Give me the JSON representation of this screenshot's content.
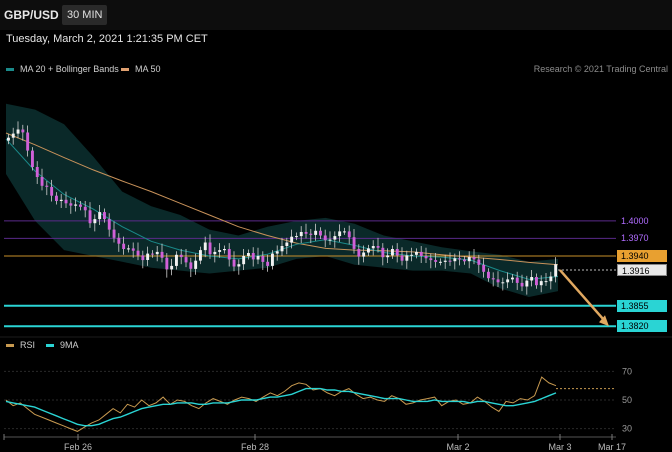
{
  "header": {
    "symbol": "GBP/USD",
    "timeframe": "30 MIN"
  },
  "datetime": "Tuesday, March 2, 2021 1:21:35 PM CET",
  "legend": {
    "items": [
      {
        "label": "MA 20 + Bollinger Bands",
        "color": "#1a8a8a"
      },
      {
        "label": "MA 50",
        "color": "#e0a070"
      }
    ],
    "credit": "Research © 2021 Trading Central"
  },
  "rsi_legend": {
    "items": [
      {
        "label": "RSI",
        "color": "#c89a50"
      },
      {
        "label": "9MA",
        "color": "#2ad4d4"
      }
    ]
  },
  "price_levels": [
    {
      "label": "1.4000",
      "color": "#a060e0",
      "text_color": "#b06cff",
      "bg": "",
      "line": "#5a2a8a"
    },
    {
      "label": "1.3970",
      "color": "#a060e0",
      "text_color": "#b06cff",
      "bg": "",
      "line": "#5a2a8a"
    },
    {
      "label": "1.3940",
      "color": "#e8a030",
      "text_color": "#000000",
      "bg": "#e8a030",
      "line": "#c8902a"
    },
    {
      "label": "1.3916",
      "color": "#ffffff",
      "text_color": "#000000",
      "bg": "#e8e8e8",
      "line": "#bbbbbb"
    },
    {
      "label": "1.3855",
      "color": "#2ad4d4",
      "text_color": "#000000",
      "bg": "#2ad4d4",
      "line": "#2ad4d4"
    },
    {
      "label": "1.3820",
      "color": "#2ad4d4",
      "text_color": "#000000",
      "bg": "#2ad4d4",
      "line": "#2ad4d4"
    }
  ],
  "chart_data": [
    {
      "type": "candlestick",
      "x_labels": [
        "Feb 26",
        "Feb 28",
        "Mar 2",
        "Mar 3",
        "Mar 17"
      ],
      "ylim": [
        1.3805,
        1.4215
      ],
      "grid": false,
      "series": [
        {
          "kind": "close",
          "values": [
            1.4142,
            1.4149,
            1.4156,
            1.4151,
            1.412,
            1.4092,
            1.4075,
            1.406,
            1.4058,
            1.4043,
            1.4034,
            1.4036,
            1.403,
            1.4026,
            1.4028,
            1.4024,
            1.4018,
            1.3996,
            1.4003,
            1.4015,
            1.4003,
            1.3985,
            1.3971,
            1.3961,
            1.3952,
            1.3953,
            1.3949,
            1.3941,
            1.3933,
            1.3944,
            1.3943,
            1.3947,
            1.3937,
            1.3917,
            1.3923,
            1.3942,
            1.3938,
            1.3929,
            1.3918,
            1.3932,
            1.395,
            1.3963,
            1.3943,
            1.3947,
            1.395,
            1.3952,
            1.3934,
            1.3922,
            1.3926,
            1.394,
            1.3945,
            1.3934,
            1.394,
            1.393,
            1.3923,
            1.3944,
            1.3948,
            1.3957,
            1.3963,
            1.3973,
            1.3974,
            1.3981,
            1.3978,
            1.3976,
            1.3983,
            1.3975,
            1.3967,
            1.3968,
            1.3974,
            1.3982,
            1.3982,
            1.3972,
            1.3952,
            1.3939,
            1.3946,
            1.3953,
            1.3957,
            1.3954,
            1.3938,
            1.3941,
            1.3952,
            1.3941,
            1.3932,
            1.3941,
            1.3942,
            1.3947,
            1.394,
            1.3936,
            1.3933,
            1.393,
            1.393,
            1.3932,
            1.3931,
            1.3936,
            1.3934,
            1.3931,
            1.3938,
            1.3934,
            1.3925,
            1.3913,
            1.3902,
            1.39,
            1.3895,
            1.3895,
            1.39,
            1.3903,
            1.3894,
            1.3888,
            1.3898,
            1.3904,
            1.389,
            1.3897,
            1.3897,
            1.3905,
            1.3926
          ]
        },
        {
          "kind": "open",
          "values": [
            1.4137,
            1.4142,
            1.4149,
            1.4156,
            1.4151,
            1.412,
            1.4092,
            1.4075,
            1.406,
            1.4058,
            1.4043,
            1.4034,
            1.4036,
            1.403,
            1.4026,
            1.4028,
            1.4024,
            1.4018,
            1.3996,
            1.4003,
            1.4015,
            1.4003,
            1.3985,
            1.3971,
            1.3961,
            1.3952,
            1.3953,
            1.3949,
            1.3941,
            1.3933,
            1.3944,
            1.3943,
            1.3947,
            1.3937,
            1.3917,
            1.3923,
            1.3942,
            1.3938,
            1.3929,
            1.3918,
            1.3932,
            1.395,
            1.3963,
            1.3943,
            1.3947,
            1.395,
            1.3952,
            1.3934,
            1.3922,
            1.3926,
            1.394,
            1.3945,
            1.3934,
            1.394,
            1.393,
            1.3923,
            1.3944,
            1.3948,
            1.3957,
            1.3963,
            1.3973,
            1.3974,
            1.3981,
            1.3978,
            1.3976,
            1.3983,
            1.3975,
            1.3967,
            1.3968,
            1.3974,
            1.3982,
            1.3982,
            1.3972,
            1.3952,
            1.3939,
            1.3946,
            1.3953,
            1.3957,
            1.3954,
            1.3938,
            1.3941,
            1.3952,
            1.3941,
            1.3932,
            1.3941,
            1.3942,
            1.3947,
            1.394,
            1.3936,
            1.3933,
            1.393,
            1.393,
            1.3932,
            1.3931,
            1.3936,
            1.3934,
            1.3931,
            1.3938,
            1.3934,
            1.3925,
            1.3913,
            1.3902,
            1.39,
            1.3895,
            1.3895,
            1.39,
            1.3903,
            1.3894,
            1.3888,
            1.3898,
            1.3904,
            1.389,
            1.3897,
            1.3897,
            1.3905
          ]
        },
        {
          "kind": "ma50",
          "name": "MA 50",
          "values": [
            1.415,
            1.413,
            1.4108,
            1.4087,
            1.4068,
            1.405,
            1.403,
            1.401,
            1.399,
            1.3975,
            1.3962,
            1.3953,
            1.395,
            1.3949,
            1.3947,
            1.3942,
            1.3938,
            1.3934,
            1.3929,
            1.3925
          ]
        },
        {
          "kind": "ma20",
          "name": "MA 20",
          "values": [
            1.414,
            1.4085,
            1.4045,
            1.402,
            1.399,
            1.3965,
            1.395,
            1.394,
            1.3935,
            1.3943,
            1.396,
            1.3968,
            1.3958,
            1.3946,
            1.394,
            1.3938,
            1.3933,
            1.3915,
            1.39,
            1.3905
          ]
        },
        {
          "kind": "bb_upper",
          "values": [
            1.42,
            1.419,
            1.4165,
            1.411,
            1.405,
            1.4025,
            1.401,
            1.3985,
            1.3975,
            1.399,
            1.4,
            1.4005,
            1.3995,
            1.3975,
            1.3965,
            1.3955,
            1.3948,
            1.3942,
            1.393,
            1.3935
          ]
        },
        {
          "kind": "bb_lower",
          "values": [
            1.408,
            1.4,
            1.395,
            1.394,
            1.393,
            1.392,
            1.3915,
            1.391,
            1.3915,
            1.392,
            1.3935,
            1.394,
            1.3925,
            1.392,
            1.3915,
            1.3915,
            1.391,
            1.3885,
            1.387,
            1.388
          ]
        }
      ],
      "projection": {
        "from": 1.3916,
        "to": 1.382
      }
    },
    {
      "type": "line",
      "yticks": [
        "70",
        "50",
        "30"
      ],
      "ylim": [
        22,
        78
      ],
      "series": [
        {
          "name": "RSI",
          "values": [
            50,
            46,
            48,
            44,
            40,
            38,
            36,
            34,
            32,
            30,
            28,
            31,
            34,
            36,
            40,
            44,
            41,
            47,
            45,
            50,
            46,
            48,
            52,
            47,
            50,
            49,
            46,
            44,
            48,
            51,
            49,
            47,
            50,
            52,
            51,
            49,
            52,
            55,
            53,
            56,
            60,
            62,
            61,
            57,
            58,
            55,
            53,
            56,
            58,
            54,
            51,
            52,
            50,
            49,
            53,
            51,
            47,
            48,
            50,
            51,
            52,
            46,
            49,
            50,
            47,
            48,
            52,
            49,
            45,
            42,
            49,
            48,
            51,
            50,
            53,
            66,
            62,
            60
          ]
        },
        {
          "name": "9MA",
          "values": [
            49,
            48,
            47,
            46,
            45,
            43,
            41,
            39,
            37,
            35,
            33,
            32,
            32,
            33,
            35,
            37,
            38,
            40,
            42,
            44,
            45,
            46,
            47,
            47,
            48,
            48,
            48,
            47,
            47,
            48,
            48,
            48,
            49,
            50,
            50,
            50,
            51,
            52,
            52,
            53,
            54,
            56,
            58,
            58,
            58,
            57,
            57,
            56,
            56,
            55,
            54,
            53,
            52,
            51,
            51,
            51,
            50,
            49,
            49,
            49,
            50,
            49,
            49,
            49,
            49,
            48,
            49,
            49,
            48,
            47,
            46,
            46,
            47,
            48,
            49,
            51,
            53,
            55
          ]
        }
      ]
    }
  ]
}
